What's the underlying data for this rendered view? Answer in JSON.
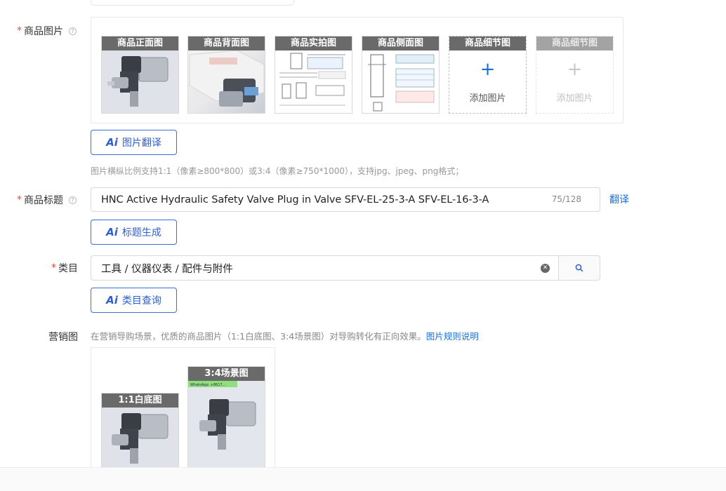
{
  "images_field": {
    "label": "商品图片",
    "required_mark": "*",
    "help_icon": "question-circle-icon",
    "slots": [
      {
        "tag": "商品正面图",
        "state": "filled",
        "kind": "product"
      },
      {
        "tag": "商品背面图",
        "state": "filled",
        "kind": "box"
      },
      {
        "tag": "商品实拍图",
        "state": "filled",
        "kind": "doc"
      },
      {
        "tag": "商品侧面图",
        "state": "filled",
        "kind": "doc"
      },
      {
        "tag": "商品细节图",
        "state": "empty",
        "add_text": "添加图片"
      },
      {
        "tag": "商品细节图",
        "state": "disabled",
        "add_text": "添加图片"
      }
    ],
    "ai_button": "图片翻译",
    "hint": "图片横纵比例支持1:1（像素≥800*800）或3:4（像素≥750*1000），支持jpg、jpeg、png格式；"
  },
  "title_field": {
    "label": "商品标题",
    "required_mark": "*",
    "value": "HNC Active Hydraulic Safety Valve Plug in Valve SFV-EL-25-3-A SFV-EL-16-3-A",
    "count": "75/128",
    "translate_link": "翻译",
    "ai_button": "标题生成"
  },
  "category_field": {
    "label": "类目",
    "required_mark": "*",
    "value": "工具 / 仪器仪表 / 配件与附件",
    "ai_button": "类目查询"
  },
  "marketing_field": {
    "label": "营销图",
    "description": "在营销导购场景，优质的商品图片（1:1白底图、3:4场景图）对导购转化有正向效果。",
    "rules_link": "图片规则说明",
    "slots": [
      {
        "tag": "1:1白底图"
      },
      {
        "tag": "3:4场景图"
      }
    ],
    "watermark_text": "WhatsApp: +8617...",
    "ai_icon": "Ai"
  },
  "colors": {
    "accent": "#1a6fd6",
    "required": "#e8473c",
    "ai_button": "#2f5fc8"
  }
}
